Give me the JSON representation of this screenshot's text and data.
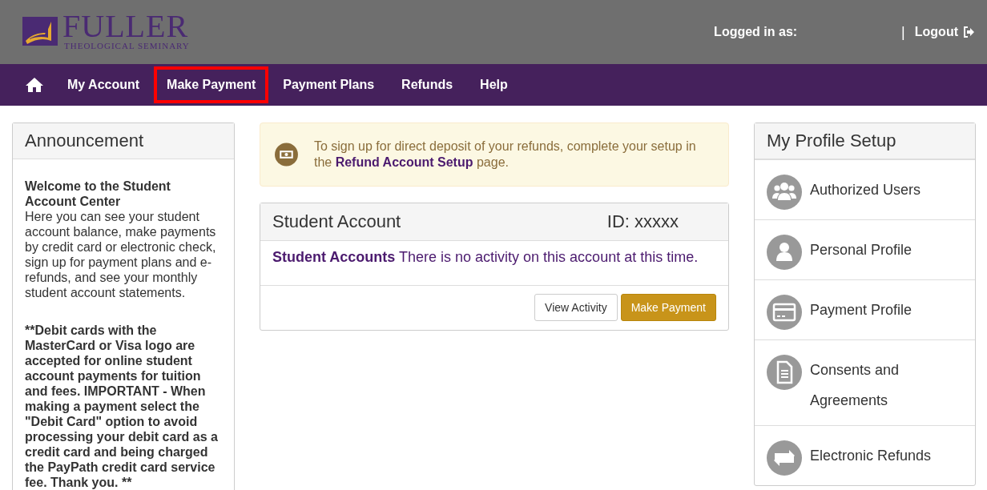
{
  "header": {
    "logo": {
      "name": "FULLER",
      "subtitle": "THEOLOGICAL SEMINARY"
    },
    "logged_in_label": "Logged in as:",
    "separator": "|",
    "logout": "Logout"
  },
  "nav": [
    {
      "kind": "home",
      "highlighted": false
    },
    {
      "kind": "link",
      "label": "My Account",
      "highlighted": false
    },
    {
      "kind": "link",
      "label": "Make Payment",
      "highlighted": true
    },
    {
      "kind": "link",
      "label": "Payment Plans",
      "highlighted": false
    },
    {
      "kind": "link",
      "label": "Refunds",
      "highlighted": false
    },
    {
      "kind": "link",
      "label": "Help",
      "highlighted": false
    }
  ],
  "announcement": {
    "title": "Announcement",
    "heading": "Welcome to the Student Account Center",
    "body": "Here you can see your student account balance, make payments by credit card or electronic check, sign up for payment plans and e-refunds, and see your monthly student account statements.",
    "notice": "**Debit cards with the MasterCard or Visa logo are accepted for online student account payments for tuition and fees. IMPORTANT - When making a payment select the \"Debit Card\" option to avoid processing your debit card as a credit card and being charged the PayPath credit card service fee. Thank you. **"
  },
  "alert": {
    "text_before": "To sign up for direct deposit of your refunds, complete your setup in the",
    "link": "Refund Account Setup",
    "text_after": "page."
  },
  "student_account": {
    "title": "Student Account",
    "id": "ID: xxxxx",
    "message": "**Student Accounts** There is no activity on this account at this time.",
    "buttons": [
      {
        "kind": "default",
        "label": "View Activity"
      },
      {
        "kind": "primary",
        "label": "Make Payment"
      }
    ]
  },
  "profile_setup": {
    "title": "My Profile Setup",
    "items": [
      {
        "kind": "users",
        "label": "Authorized Users"
      },
      {
        "kind": "user",
        "label": "Personal Profile"
      },
      {
        "kind": "card",
        "label": "Payment Profile"
      },
      {
        "kind": "document",
        "label": "Consents and Agreements"
      },
      {
        "kind": "refresh",
        "label": "Electronic Refunds"
      }
    ]
  }
}
